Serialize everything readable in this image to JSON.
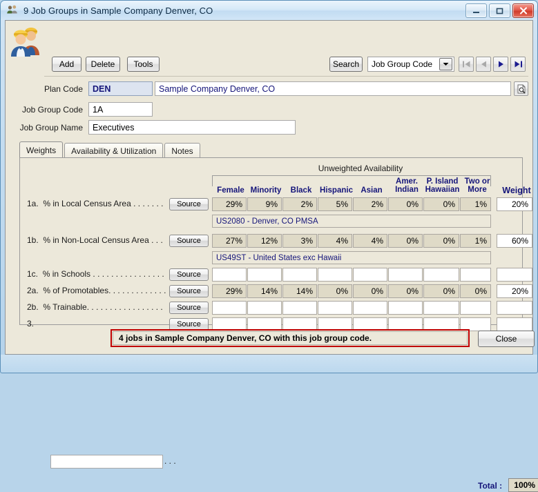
{
  "window": {
    "title": "9 Job Groups in Sample Company Denver, CO",
    "title_icon": "people-group-icon",
    "minimize_label": "Minimize",
    "maximize_label": "Maximize",
    "close_label": "Close"
  },
  "toolbar": {
    "app_icon": "two-workers-icon",
    "add_label": "Add",
    "delete_label": "Delete",
    "tools_label": "Tools",
    "search_label": "Search",
    "search_field_value": "Job Group Code",
    "dropdown_icon": "chevron-down-icon",
    "nav_first_label": "First record",
    "nav_prev_label": "Previous record",
    "nav_next_label": "Next record",
    "nav_last_label": "Last record"
  },
  "form": {
    "plan_code_label": "Plan Code",
    "plan_code_value": "DEN",
    "plan_name_value": "Sample Company Denver, CO",
    "lookup_icon": "document-search-icon",
    "job_group_code_label": "Job Group Code",
    "job_group_code_value": "1A",
    "job_group_name_label": "Job Group Name",
    "job_group_name_value": "Executives"
  },
  "tabs": [
    {
      "label": "Weights",
      "active": true
    },
    {
      "label": "Availability & Utilization",
      "active": false
    },
    {
      "label": "Notes",
      "active": false
    }
  ],
  "grid": {
    "group_title": "Unweighted Availability",
    "columns": [
      {
        "line1": "Female",
        "line2": ""
      },
      {
        "line1": "Minority",
        "line2": ""
      },
      {
        "line1": "Black",
        "line2": ""
      },
      {
        "line1": "Hispanic",
        "line2": ""
      },
      {
        "line1": "Asian",
        "line2": ""
      },
      {
        "line1": "Amer.",
        "line2": "Indian"
      },
      {
        "line1": "P. Island",
        "line2": "Hawaiian"
      },
      {
        "line1": "Two or",
        "line2": "More"
      }
    ],
    "weight_column_label": "Weight",
    "source_button_label": "Source",
    "dots": ". . . . . . .",
    "rows": [
      {
        "num": "1a.",
        "label": "% in Local Census Area",
        "dots": ". . . . . . .",
        "values": [
          "29%",
          "9%",
          "2%",
          "5%",
          "2%",
          "0%",
          "0%",
          "1%"
        ],
        "weight": "20%",
        "readonly": true,
        "source_text": "US2080 - Denver, CO PMSA"
      },
      {
        "num": "1b.",
        "label": "% in Non-Local Census Area",
        "dots": ". . .",
        "values": [
          "27%",
          "12%",
          "3%",
          "4%",
          "4%",
          "0%",
          "0%",
          "1%"
        ],
        "weight": "60%",
        "readonly": true,
        "source_text": "US49ST - United States exc Hawaii"
      },
      {
        "num": "1c.",
        "label": "% in Schools",
        "dots": ". . . . . . . . . . . . . . . .",
        "values": [
          "",
          "",
          "",
          "",
          "",
          "",
          "",
          ""
        ],
        "weight": "",
        "readonly": false,
        "source_text": null
      },
      {
        "num": "2a.",
        "label": "% of Promotables.",
        "dots": ". . . . . . . . . . . .",
        "values": [
          "29%",
          "14%",
          "14%",
          "0%",
          "0%",
          "0%",
          "0%",
          "0%"
        ],
        "weight": "20%",
        "readonly": true,
        "source_text": null
      },
      {
        "num": "2b.",
        "label": "% Trainable.",
        "dots": ". . . . . . . . . . . . . . . .",
        "values": [
          "",
          "",
          "",
          "",
          "",
          "",
          "",
          ""
        ],
        "weight": "",
        "readonly": false,
        "source_text": null
      },
      {
        "num": "3.",
        "label": "",
        "dots": ". . .",
        "values": [
          "",
          "",
          "",
          "",
          "",
          "",
          "",
          ""
        ],
        "weight": "",
        "readonly": false,
        "source_text": null,
        "has_description_input": true,
        "description_value": ""
      }
    ],
    "total_label": "Total :",
    "total_value": "100%"
  },
  "statusbar": {
    "message": "4 jobs in Sample Company Denver, CO with this job group code.",
    "close_label": "Close",
    "highlight_color": "#c00000"
  },
  "colors": {
    "header_text": "#15157a",
    "readonly_cell": "#dfdac7",
    "panel_bg": "#ece8da",
    "plan_code_bg": "#dde4f0"
  }
}
